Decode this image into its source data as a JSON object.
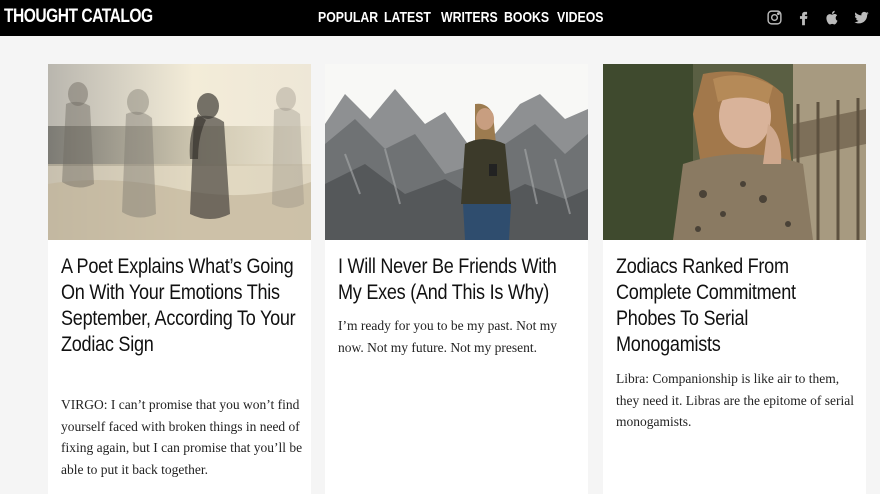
{
  "header": {
    "logo": "THOUGHT CATALOG",
    "nav": [
      "POPULAR",
      "LATEST",
      "WRITERS",
      "BOOKS",
      "VIDEOS"
    ],
    "social_icons": [
      "instagram-icon",
      "facebook-icon",
      "apple-icon",
      "twitter-icon"
    ]
  },
  "cards": [
    {
      "title": "A Poet Explains What’s Going On With Your Emotions This September, According To Your Zodiac Sign",
      "excerpt": "VIRGO: I can’t promise that you won’t find yourself faced with broken things in need of fixing again, but I can promise that you’ll be able to put it back together."
    },
    {
      "title": "I Will Never Be Friends With My Exes (And This Is Why)",
      "excerpt": "I’m ready for you to be my past. Not my now. Not my future. Not my present."
    },
    {
      "title": "Zodiacs Ranked From Complete Commitment Phobes To Serial Monogamists",
      "excerpt": "Libra: Companionship is like air to them, they need it. Libras are the epitome of serial monogamists."
    }
  ]
}
